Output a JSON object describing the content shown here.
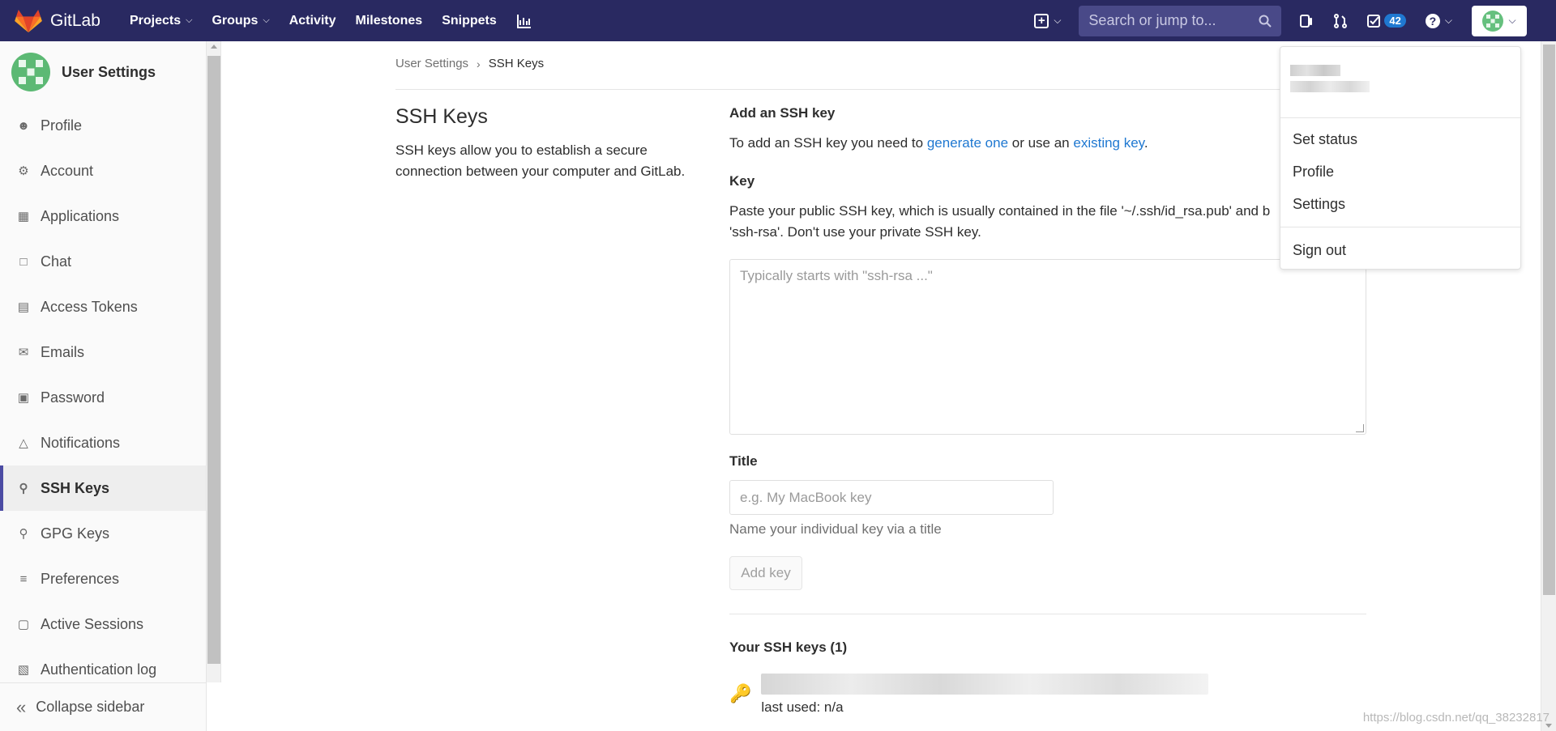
{
  "navbar": {
    "brand": "GitLab",
    "links": [
      {
        "label": "Projects",
        "dropdown": true
      },
      {
        "label": "Groups",
        "dropdown": true
      },
      {
        "label": "Activity",
        "dropdown": false
      },
      {
        "label": "Milestones",
        "dropdown": false
      },
      {
        "label": "Snippets",
        "dropdown": false
      }
    ],
    "search_placeholder": "Search or jump to...",
    "todo_count": "42",
    "colors": {
      "nav_bg": "#292961",
      "accent": "#1f78d1"
    }
  },
  "sidebar": {
    "title": "User Settings",
    "items": [
      {
        "label": "Profile",
        "icon": "profile-icon"
      },
      {
        "label": "Account",
        "icon": "account-icon"
      },
      {
        "label": "Applications",
        "icon": "applications-icon"
      },
      {
        "label": "Chat",
        "icon": "chat-icon"
      },
      {
        "label": "Access Tokens",
        "icon": "token-icon"
      },
      {
        "label": "Emails",
        "icon": "mail-icon"
      },
      {
        "label": "Password",
        "icon": "lock-icon"
      },
      {
        "label": "Notifications",
        "icon": "bell-icon"
      },
      {
        "label": "SSH Keys",
        "icon": "key-icon",
        "active": true
      },
      {
        "label": "GPG Keys",
        "icon": "key-icon"
      },
      {
        "label": "Preferences",
        "icon": "sliders-icon"
      },
      {
        "label": "Active Sessions",
        "icon": "monitor-icon"
      },
      {
        "label": "Authentication log",
        "icon": "log-icon"
      }
    ],
    "collapse_label": "Collapse sidebar"
  },
  "breadcrumb": {
    "parent": "User Settings",
    "current": "SSH Keys"
  },
  "left": {
    "title": "SSH Keys",
    "description": "SSH keys allow you to establish a secure connection between your computer and GitLab."
  },
  "form": {
    "heading": "Add an SSH key",
    "intro_prefix": "To add an SSH key you need to ",
    "intro_link1": "generate one",
    "intro_mid": " or use an ",
    "intro_link2": "existing key",
    "intro_suffix": ".",
    "key_label": "Key",
    "key_help_line1": "Paste your public SSH key, which is usually contained in the file '~/.ssh/id_rsa.pub' and b",
    "key_help_line2": "'ssh-rsa'. Don't use your private SSH key.",
    "key_placeholder": "Typically starts with \"ssh-rsa ...\"",
    "title_label": "Title",
    "title_placeholder": "e.g. My MacBook key",
    "title_help": "Name your individual key via a title",
    "add_button": "Add key"
  },
  "keys": {
    "heading": "Your SSH keys (1)",
    "last_used": "last used: n/a"
  },
  "user_dropdown": {
    "items_primary": [
      "Set status",
      "Profile",
      "Settings"
    ],
    "sign_out": "Sign out"
  },
  "watermark": "https://blog.csdn.net/qq_38232817"
}
